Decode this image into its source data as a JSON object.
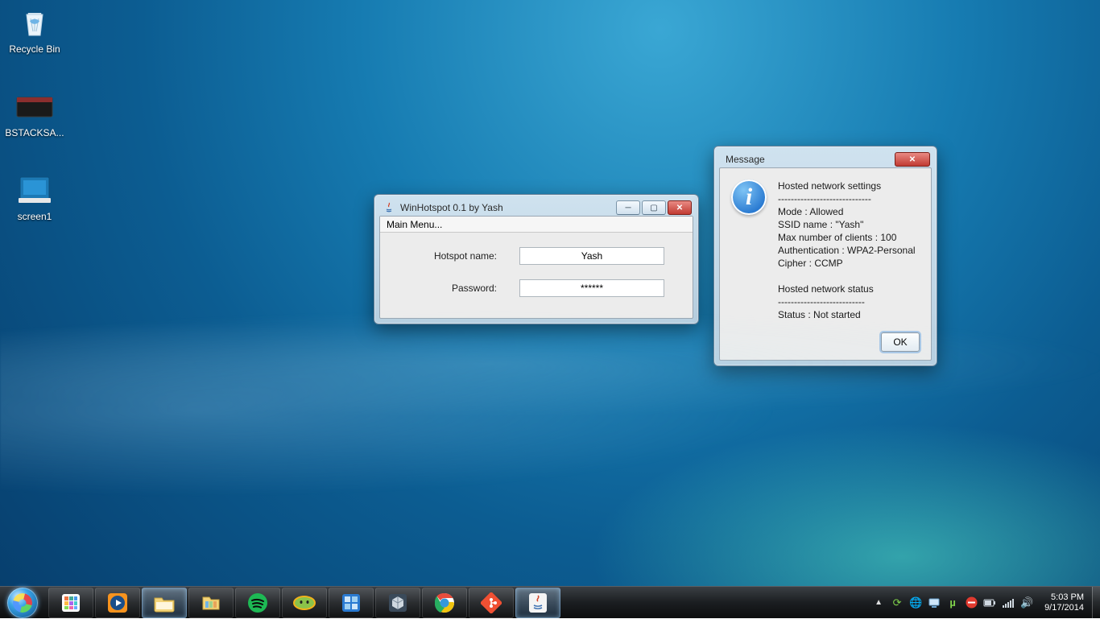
{
  "desktop_icons": {
    "recycle_bin": "Recycle Bin",
    "bstacks": "BSTACKSA...",
    "screen1": "screen1"
  },
  "hotspot_window": {
    "title": "WinHotspot 0.1 by Yash",
    "menu": "Main Menu...",
    "name_label": "Hotspot name:",
    "name_value": "Yash",
    "pwd_label": "Password:",
    "pwd_value": "******"
  },
  "message_dialog": {
    "title": "Message",
    "heading_settings": "Hosted network settings",
    "sep": "-----------------------------",
    "mode": "Mode : Allowed",
    "ssid": "SSID name : \"Yash\"",
    "max": "Max number of clients : 100",
    "auth": "Authentication : WPA2-Personal",
    "cipher": "Cipher : CCMP",
    "heading_status": "Hosted network status",
    "sep2": "---------------------------",
    "status": "Status : Not started",
    "ok": "OK"
  },
  "taskbar": {
    "time": "5:03 PM",
    "date": "9/17/2014"
  }
}
